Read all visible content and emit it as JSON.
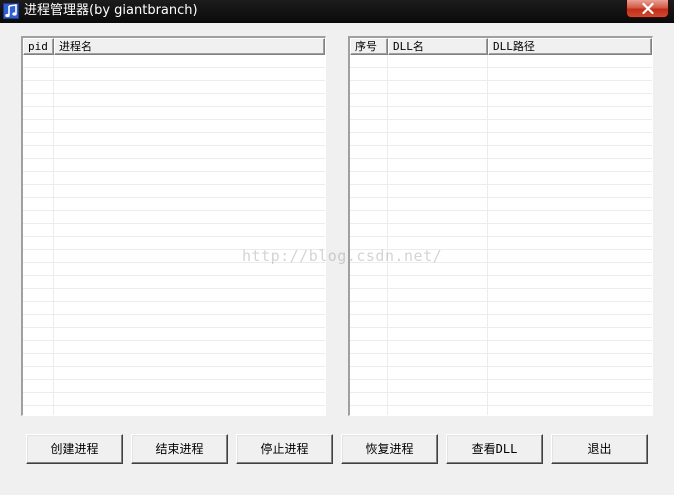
{
  "window": {
    "title": "进程管理器(by giantbranch)",
    "app_icon": "music-note-icon",
    "close_icon": "close-icon"
  },
  "process_list": {
    "columns": [
      {
        "label": "pid"
      },
      {
        "label": "进程名"
      }
    ],
    "rows": []
  },
  "dll_list": {
    "columns": [
      {
        "label": "序号"
      },
      {
        "label": "DLL名"
      },
      {
        "label": "DLL路径"
      }
    ],
    "rows": []
  },
  "buttons": {
    "create": "创建进程",
    "end": "结束进程",
    "stop": "停止进程",
    "resume": "恢复进程",
    "view_dll": "查看DLL",
    "exit": "退出"
  },
  "watermark": "http://blog.csdn.net/",
  "colors": {
    "titlebar": "#0a0a0a",
    "close_button": "#c12e18",
    "window_bg": "#f0f0f0",
    "list_bg": "#ffffff"
  }
}
